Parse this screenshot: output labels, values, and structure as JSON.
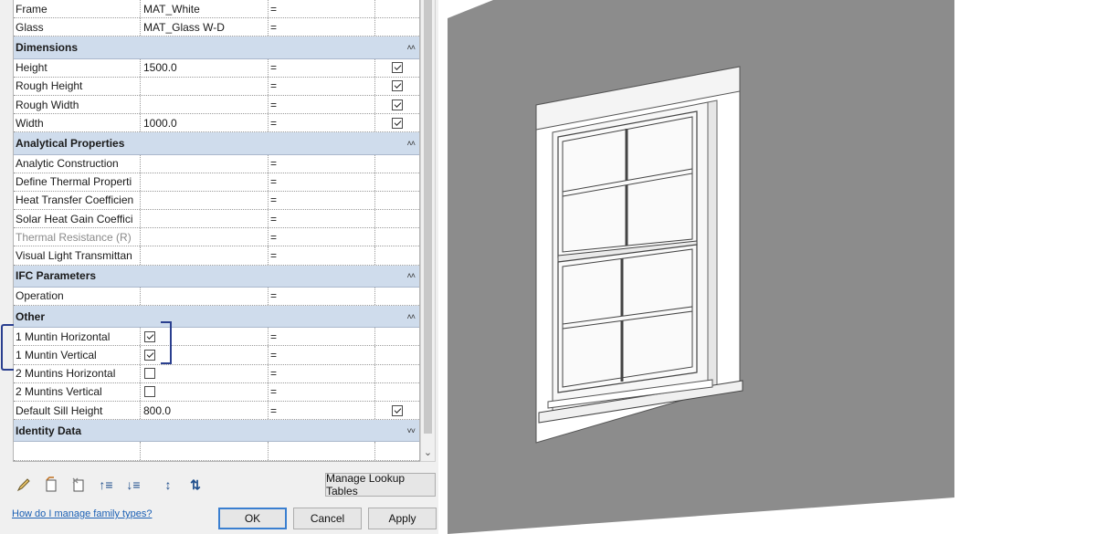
{
  "properties": {
    "rows_top": [
      {
        "name": "Frame",
        "value": "MAT_White",
        "formula": "="
      },
      {
        "name": "Glass",
        "value": "MAT_Glass W-D",
        "formula": "="
      }
    ],
    "groups": [
      {
        "title": "Dimensions",
        "rows": [
          {
            "name": "Height",
            "value": "1500.0",
            "formula": "=",
            "lock": true
          },
          {
            "name": "Rough Height",
            "value": "",
            "formula": "=",
            "lock": true
          },
          {
            "name": "Rough Width",
            "value": "",
            "formula": "=",
            "lock": true
          },
          {
            "name": "Width",
            "value": "1000.0",
            "formula": "=",
            "lock": true
          }
        ]
      },
      {
        "title": "Analytical Properties",
        "rows": [
          {
            "name": "Analytic Construction",
            "value": "",
            "formula": "="
          },
          {
            "name": "Define Thermal Properti",
            "value": "",
            "formula": "="
          },
          {
            "name": "Heat Transfer Coefficien",
            "value": "",
            "formula": "="
          },
          {
            "name": "Solar Heat Gain Coeffici",
            "value": "",
            "formula": "="
          },
          {
            "name": "Thermal Resistance (R)",
            "value": "",
            "formula": "=",
            "grayed": true
          },
          {
            "name": "Visual Light Transmittan",
            "value": "",
            "formula": "="
          }
        ]
      },
      {
        "title": "IFC Parameters",
        "rows": [
          {
            "name": "Operation",
            "value": "",
            "formula": "="
          }
        ]
      },
      {
        "title": "Other",
        "rows": [
          {
            "name": "1 Muntin Horizontal",
            "checkbox": true,
            "formula": "="
          },
          {
            "name": "1 Muntin Vertical",
            "checkbox": true,
            "formula": "="
          },
          {
            "name": "2 Muntins Horizontal",
            "checkbox": false,
            "formula": "="
          },
          {
            "name": "2 Muntins Vertical",
            "checkbox": false,
            "formula": "="
          },
          {
            "name": "Default Sill Height",
            "value": "800.0",
            "formula": "=",
            "lock": true
          }
        ]
      },
      {
        "title": "Identity Data",
        "rows": [
          {
            "name": "",
            "value": "",
            "formula": ""
          }
        ]
      }
    ]
  },
  "toolbar": {
    "icons": [
      "edit-pencil-icon",
      "new-parameter-icon",
      "delete-parameter-icon",
      "move-up-icon",
      "move-down-icon",
      "sort-ascending-icon",
      "sort-descending-icon"
    ],
    "manage_lookup_label": "Manage Lookup Tables"
  },
  "footer": {
    "help_link": "How do I manage family types?",
    "ok_label": "OK",
    "cancel_label": "Cancel",
    "apply_label": "Apply"
  },
  "colors": {
    "group_header": "#cfdcec",
    "annotation": "#2a3f8f",
    "wall": "#8a8a8a",
    "link": "#1a5fb4"
  }
}
